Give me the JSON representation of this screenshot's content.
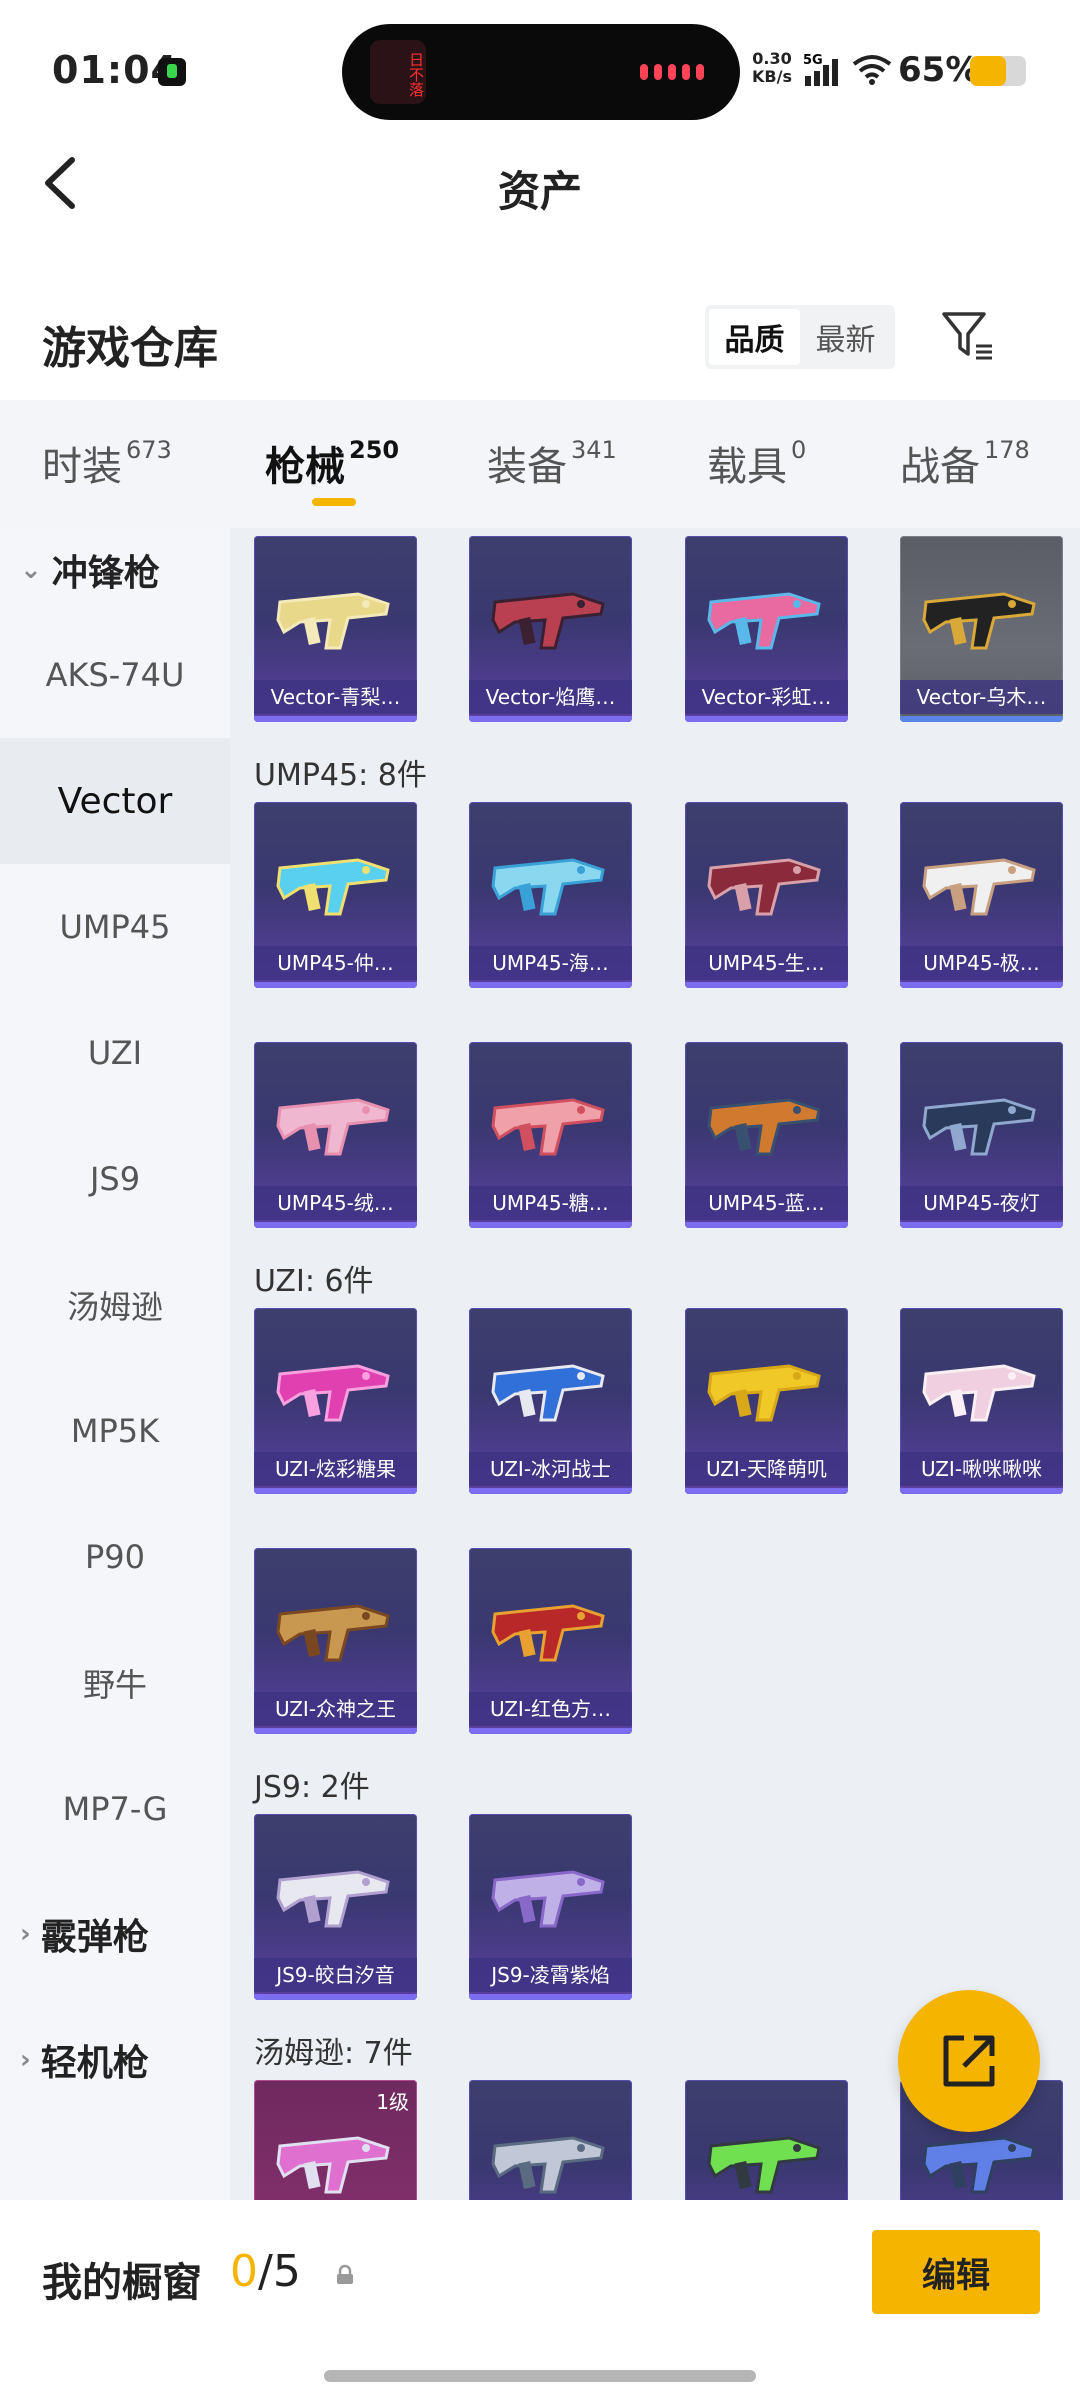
{
  "status": {
    "time": "01:04",
    "island_text": "日不落",
    "net_speed_value": "0.30",
    "net_speed_unit": "KB/s",
    "network": "5G",
    "battery_percent": "65%",
    "battery_level": 0.65
  },
  "header": {
    "title": "资产",
    "back_icon": "chevron-left-icon"
  },
  "section": {
    "title": "游戏仓库",
    "sort_options": [
      "品质",
      "最新"
    ],
    "sort_active": "品质",
    "filter_icon": "filter-icon"
  },
  "tabs": [
    {
      "label": "时装",
      "count": "673"
    },
    {
      "label": "枪械",
      "count": "250"
    },
    {
      "label": "装备",
      "count": "341"
    },
    {
      "label": "载具",
      "count": "0"
    },
    {
      "label": "战备",
      "count": "178"
    }
  ],
  "tabs_active": "枪械",
  "sidebar": {
    "items": [
      {
        "label": "冲锋枪",
        "type": "group-expanded"
      },
      {
        "label": "AKS-74U",
        "type": "item"
      },
      {
        "label": "Vector",
        "type": "item-active"
      },
      {
        "label": "UMP45",
        "type": "item"
      },
      {
        "label": "UZI",
        "type": "item"
      },
      {
        "label": "JS9",
        "type": "item"
      },
      {
        "label": "汤姆逊",
        "type": "item"
      },
      {
        "label": "MP5K",
        "type": "item"
      },
      {
        "label": "P90",
        "type": "item"
      },
      {
        "label": "野牛",
        "type": "item"
      },
      {
        "label": "MP7-G",
        "type": "item"
      },
      {
        "label": "霰弹枪",
        "type": "group-collapsed"
      },
      {
        "label": "轻机枪",
        "type": "group-collapsed"
      }
    ]
  },
  "groups": [
    {
      "header": "",
      "items": [
        "Vector-青梨…",
        "Vector-焰鹰…",
        "Vector-彩虹…",
        "Vector-乌木…"
      ]
    },
    {
      "header": "UMP45: 8件",
      "items": [
        "UMP45-仲…",
        "UMP45-海…",
        "UMP45-生…",
        "UMP45-极…",
        "UMP45-绒…",
        "UMP45-糖…",
        "UMP45-蓝…",
        "UMP45-夜灯"
      ]
    },
    {
      "header": "UZI: 6件",
      "items": [
        "UZI-炫彩糖果",
        "UZI-冰河战士",
        "UZI-天降萌叽",
        "UZI-啾咪啾咪",
        "UZI-众神之王",
        "UZI-红色方…"
      ]
    },
    {
      "header": "JS9: 2件",
      "items": [
        "JS9-皎白汐音",
        "JS9-凌霄紫焰"
      ]
    },
    {
      "header": "汤姆逊: 7件",
      "items": [
        "",
        "",
        "",
        ""
      ],
      "first_level": "1级"
    }
  ],
  "fab_icon": "share-external-icon",
  "bottom": {
    "showcase_label": "我的橱窗",
    "showcase_current": "0",
    "showcase_total": "/5",
    "lock_icon": "lock-icon",
    "edit_label": "编辑"
  }
}
